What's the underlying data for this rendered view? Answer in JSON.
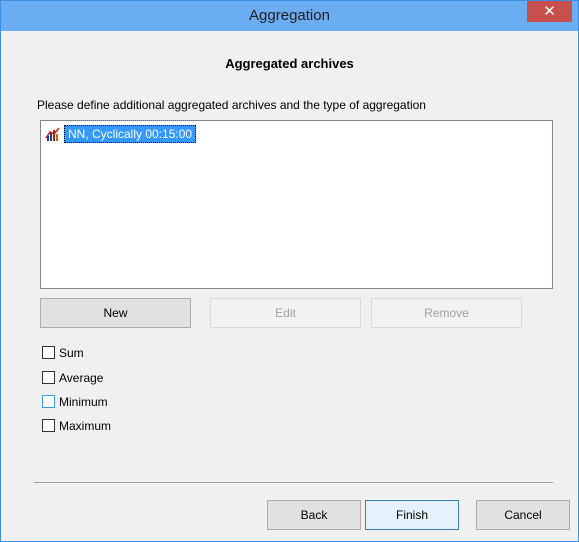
{
  "window": {
    "title": "Aggregation",
    "close_label": "✕"
  },
  "header": {
    "heading": "Aggregated archives",
    "instruction": "Please define additional aggregated archives and the type of aggregation"
  },
  "archives_list": {
    "items": [
      {
        "label": "NN, Cyclically 00:15:00",
        "icon": "aggregated-archive-icon",
        "selected": true
      }
    ]
  },
  "list_buttons": {
    "new": "New",
    "edit": "Edit",
    "remove": "Remove"
  },
  "aggregation_types": [
    {
      "label": "Sum",
      "checked": false
    },
    {
      "label": "Average",
      "checked": false
    },
    {
      "label": "Minimum",
      "checked": false
    },
    {
      "label": "Maximum",
      "checked": false
    }
  ],
  "footer": {
    "back": "Back",
    "finish": "Finish",
    "cancel": "Cancel"
  },
  "colors": {
    "titlebar": "#6badf3",
    "close": "#c7504c",
    "selection": "#3399ff",
    "default_button_border": "#3c7fb1"
  }
}
